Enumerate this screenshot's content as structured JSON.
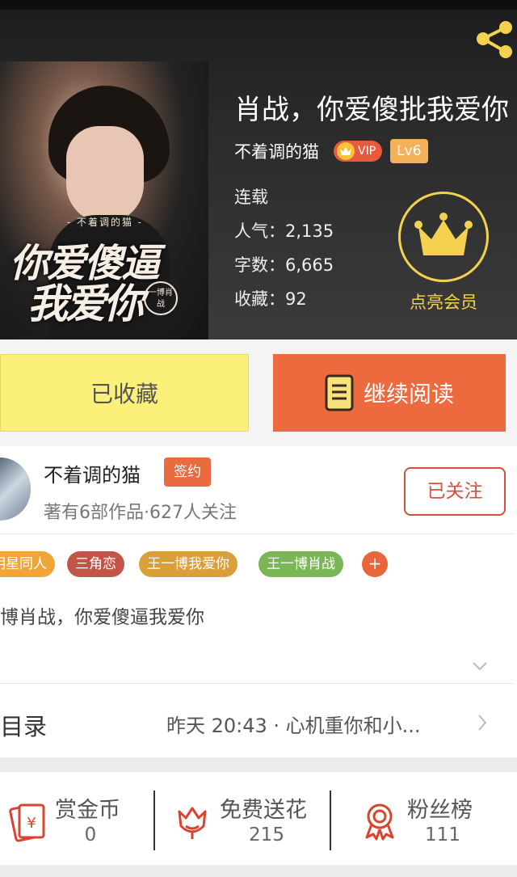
{
  "book": {
    "title": "肖战，你爱傻批我爱你",
    "author": "不着调的猫",
    "vip_label": "VIP",
    "level_label": "Lv6",
    "status": "连载",
    "popularity": "人气：2,135",
    "word_count": "字数：6,665",
    "favorites": "收藏：92",
    "cover_small": "- 不着调的猫 -",
    "cover_line1": "你爱傻逼",
    "cover_line2": "我爱你",
    "cover_seal": "一博肖战"
  },
  "membership": {
    "label": "点亮会员"
  },
  "actions": {
    "favorited_label": "已收藏",
    "continue_label": "继续阅读"
  },
  "author_info": {
    "name": "不着调的猫",
    "badge": "签约",
    "meta": "著有6部作品·627人关注",
    "follow_label": "已关注"
  },
  "tags": [
    {
      "label": "明星同人",
      "color": "#f0a53a"
    },
    {
      "label": "三角恋",
      "color": "#c2554a"
    },
    {
      "label": "王一博我爱你",
      "color": "#d9a03a"
    },
    {
      "label": "王一博肖战",
      "color": "#7ab556"
    }
  ],
  "tag_more": "+",
  "description": "博肖战，你爱傻逼我爱你",
  "toc": {
    "label": "目录",
    "latest": "昨天 20:43 · 心机重你和小..."
  },
  "stats": [
    {
      "label": "赏金币",
      "value": "0",
      "icon": "red-envelope-icon"
    },
    {
      "label": "免费送花",
      "value": "215",
      "icon": "flower-icon"
    },
    {
      "label": "粉丝榜",
      "value": "111",
      "icon": "medal-icon"
    }
  ],
  "colors": {
    "accent_orange": "#ec6a3d",
    "fav_yellow": "#fbf07a",
    "crown_gold": "#f4d24f",
    "icon_red": "#d8442f"
  }
}
